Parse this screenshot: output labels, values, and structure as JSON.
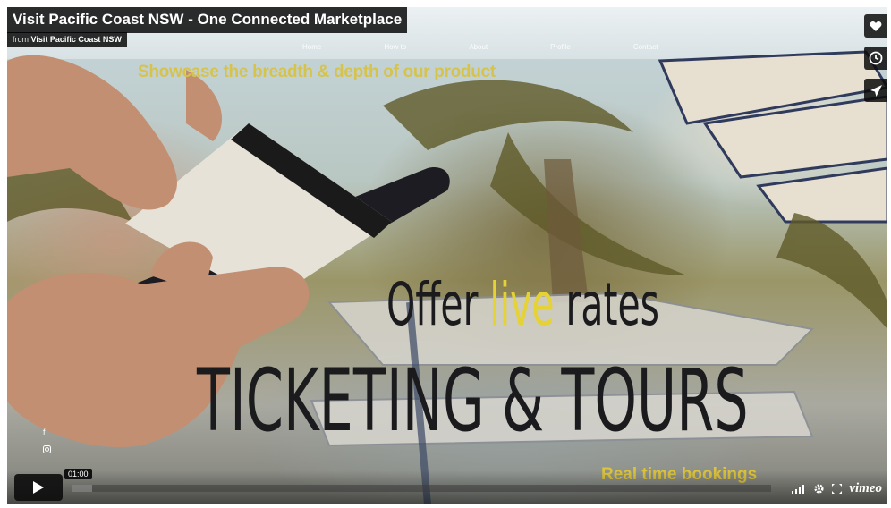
{
  "video": {
    "title": "Visit Pacific Coast NSW - One Connected Marketplace",
    "byline_prefix": "from",
    "byline_author": "Visit Pacific Coast NSW"
  },
  "site_nav": [
    "Home",
    "How to",
    "About",
    "Profile",
    "Contact"
  ],
  "overlay": {
    "tagline": "Showcase the breadth & depth of our product",
    "headline_word1": "Offer",
    "headline_highlight": "live",
    "headline_word3": "rates",
    "headline_line2": "TICKETING & TOURS",
    "subline": "Real time bookings"
  },
  "social_icons": [
    "facebook-icon",
    "instagram-icon"
  ],
  "side_actions": [
    {
      "name": "like-button",
      "icon": "heart-icon"
    },
    {
      "name": "watch-later-button",
      "icon": "clock-icon"
    },
    {
      "name": "share-button",
      "icon": "paper-plane-icon"
    }
  ],
  "controls": {
    "time": "01:00",
    "progress_fraction": 0.03,
    "brand": "vimeo",
    "icons": [
      "volume-icon",
      "settings-icon",
      "fullscreen-icon"
    ]
  },
  "colors": {
    "highlight": "#e5d234",
    "tagline": "#d6c34c",
    "headline": "#1b1b1e",
    "player_chrome": "#111111"
  }
}
